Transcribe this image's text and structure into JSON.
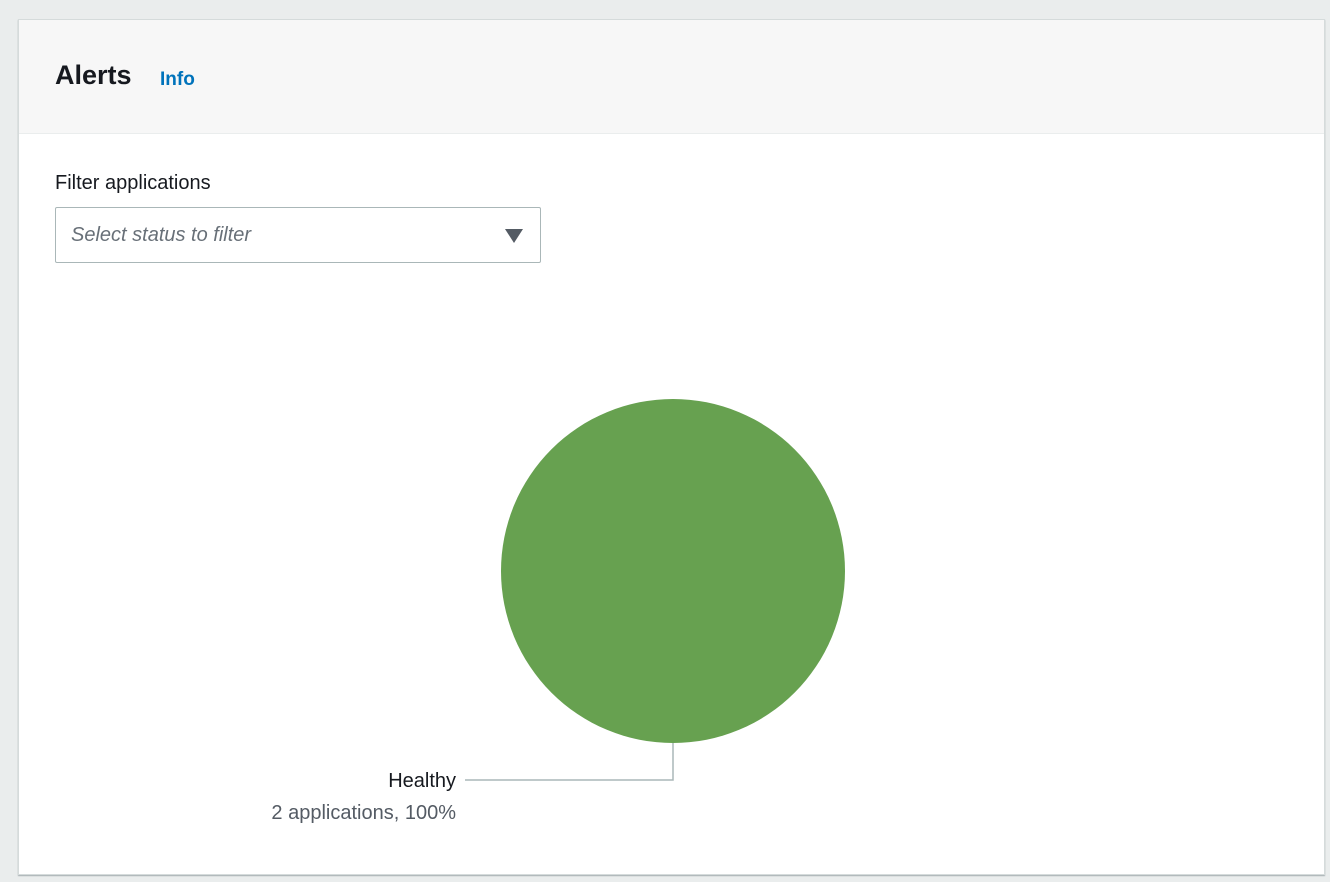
{
  "card": {
    "title": "Alerts",
    "info_label": "Info"
  },
  "filter": {
    "label": "Filter applications",
    "placeholder": "Select status to filter"
  },
  "chart_data": {
    "type": "pie",
    "title": "",
    "slices": [
      {
        "label": "Healthy",
        "value": 2,
        "percent": 100,
        "detail": "2 applications, 100%",
        "color": "#67a150"
      }
    ]
  },
  "colors": {
    "accent_link": "#0073bb",
    "healthy": "#67a150"
  }
}
